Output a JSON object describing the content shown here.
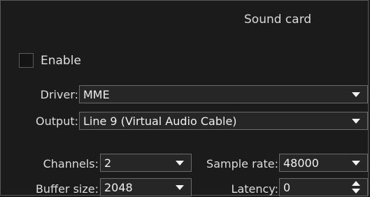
{
  "header": {
    "title": "Sound card"
  },
  "enable": {
    "label": "Enable",
    "checked": false
  },
  "driver": {
    "label": "Driver:",
    "value": "MME",
    "icon": "chevron-down-icon"
  },
  "output": {
    "label": "Output:",
    "value": "Line 9 (Virtual Audio Cable)",
    "icon": "chevron-down-icon"
  },
  "channels": {
    "label": "Channels:",
    "value": "2",
    "icon": "chevron-down-icon"
  },
  "sample_rate": {
    "label": "Sample rate:",
    "value": "48000",
    "icon": "chevron-down-icon"
  },
  "buffer_size": {
    "label": "Buffer size:",
    "value": "2048",
    "icon": "chevron-down-icon"
  },
  "latency": {
    "label": "Latency:",
    "value": "0",
    "icons": [
      "spin-up-icon",
      "spin-down-icon"
    ]
  },
  "colors": {
    "background": "#1b1b1b",
    "field": "#262626",
    "border": "#6a6a6a",
    "text": "#e6e6e6"
  }
}
